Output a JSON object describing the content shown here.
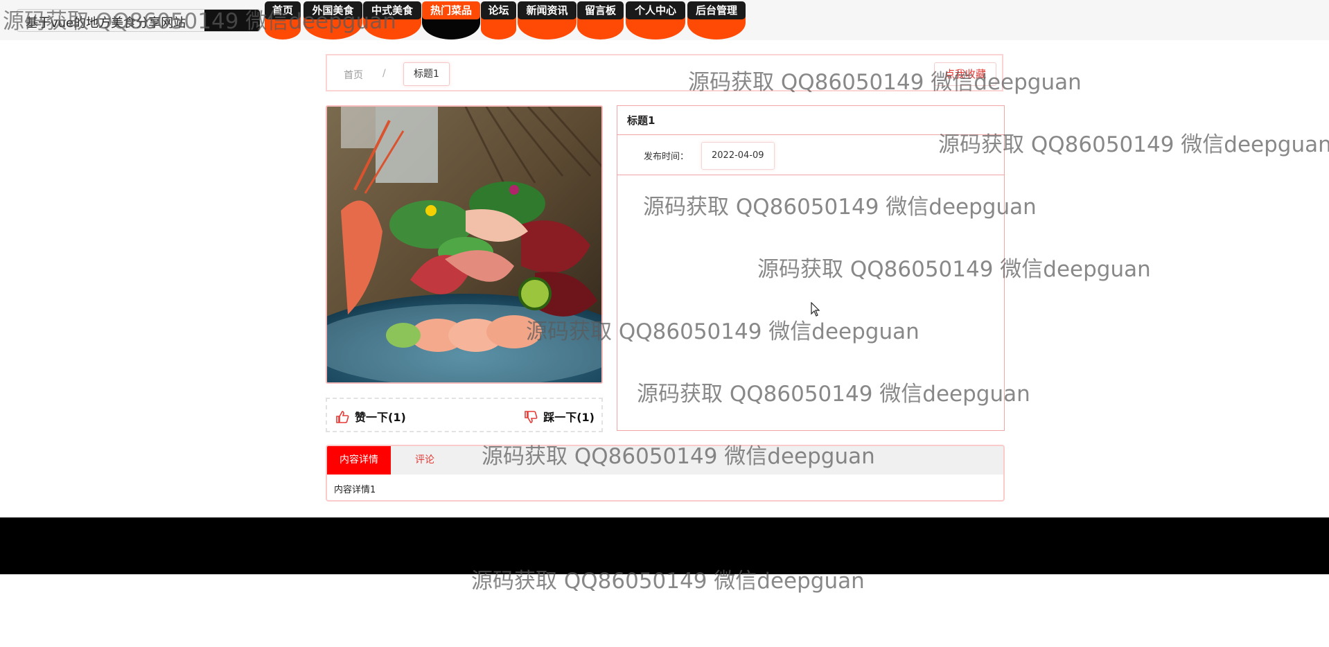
{
  "header": {
    "site_title": "基于vue的地方美食分享网站",
    "nav": [
      {
        "label": "首页",
        "active": false
      },
      {
        "label": "外国美食",
        "active": false
      },
      {
        "label": "中式美食",
        "active": false
      },
      {
        "label": "热门菜品",
        "active": true
      },
      {
        "label": "论坛",
        "active": false
      },
      {
        "label": "新闻资讯",
        "active": false
      },
      {
        "label": "留言板",
        "active": false
      },
      {
        "label": "个人中心",
        "active": false
      },
      {
        "label": "后台管理",
        "active": false
      }
    ]
  },
  "breadcrumb": {
    "home": "首页",
    "separator": "/",
    "current": "标题1",
    "favorite_label": "点我收藏"
  },
  "detail": {
    "title": "标题1",
    "publish_time_label": "发布时间：",
    "publish_time": "2022-04-09",
    "like_label": "赞一下(1)",
    "dislike_label": "踩一下(1)"
  },
  "tabs": {
    "items": [
      "内容详情",
      "评论"
    ],
    "active_content": "内容详情1"
  },
  "watermark": "源码获取 QQ86050149 微信deepguan",
  "icons": {
    "like": "thumb-up-icon",
    "dislike": "thumb-down-icon"
  },
  "colors": {
    "accent": "#ff4a06",
    "nav_bg": "#1a1a1a",
    "tab_active": "#ff0000",
    "border_pink": "#f2a5a5"
  }
}
